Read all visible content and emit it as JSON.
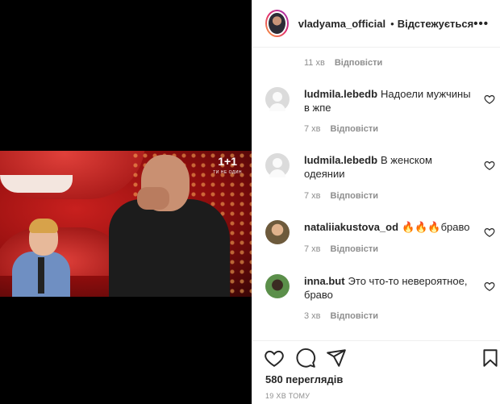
{
  "video": {
    "channel": "1+1",
    "channel_sub": "ТИ НЕ ОДИН"
  },
  "header": {
    "username": "vladyama_official",
    "separator": "•",
    "follow_label": "Відстежується",
    "more": "•••"
  },
  "top_meta": {
    "time": "11 хв",
    "reply": "Відповісти"
  },
  "comments": [
    {
      "user": "ludmila.lebedb",
      "text": "Надоели мужчины в жпе",
      "time": "7 хв",
      "reply": "Відповісти"
    },
    {
      "user": "ludmila.lebedb",
      "text": "В женском одеянии",
      "time": "7 хв",
      "reply": "Відповісти"
    },
    {
      "user": "nataliiakustova_od",
      "text": "🔥🔥🔥браво",
      "time": "7 хв",
      "reply": "Відповісти"
    },
    {
      "user": "inna.but",
      "text": "Это что-то невероятное, браво",
      "time": "3 хв",
      "reply": "Відповісти"
    }
  ],
  "stats": {
    "views": "580 переглядів",
    "posted": "19 ХВ ТОМУ"
  }
}
